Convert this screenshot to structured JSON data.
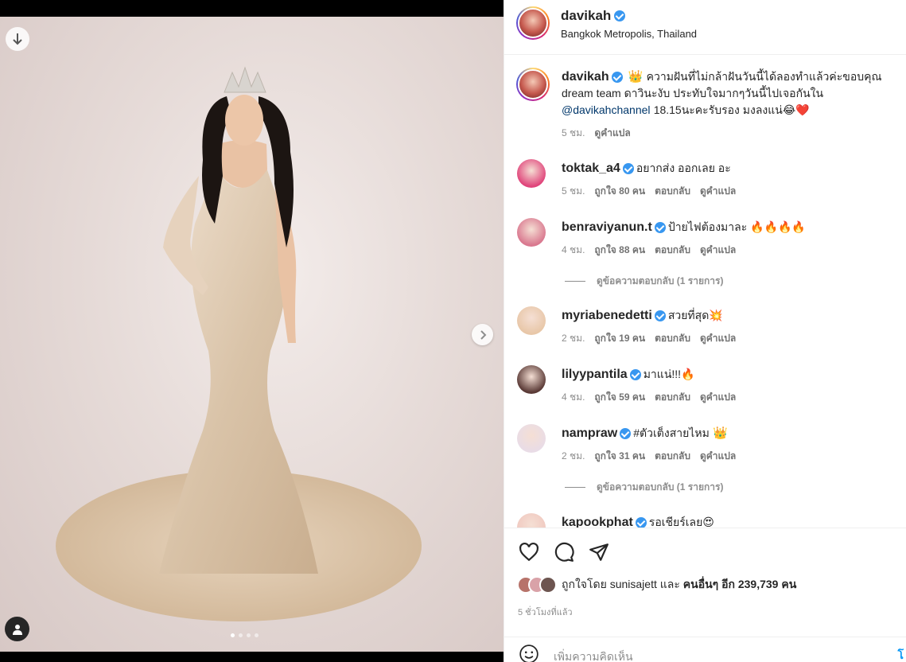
{
  "post": {
    "author": "davikah",
    "location": "Bangkok Metropolis, Thailand"
  },
  "caption": {
    "username": "davikah",
    "crown": "👑",
    "text_part1": "ความฝันที่ไม่กล้าฝันวันนี้ได้ลองทำแล้วค่ะขอบคุณ dream team ดาวินะงับ ประทับใจมากๆวันนี้ไปเจอกันใน",
    "mention": "@davikahchannel",
    "text_part2": "18.15นะคะรับรอง มงลงแน่😂❤️",
    "time": "5 ชม.",
    "translate": "ดูคำแปล"
  },
  "comments": [
    {
      "username": "toktak_a4",
      "text": "อยากส่ง ออกเลย อะ",
      "time": "5 ชม.",
      "likes": "ถูกใจ 80 คน",
      "reply": "ตอบกลับ",
      "translate": "ดูคำแปล",
      "avatar_color": "#e0457b"
    },
    {
      "username": "benraviyanun.t",
      "text": "ป้ายไฟต้องมาละ 🔥🔥🔥🔥",
      "time": "4 ชม.",
      "likes": "ถูกใจ 88 คน",
      "reply": "ตอบกลับ",
      "translate": "ดูคำแปล",
      "avatar_color": "#d9788f",
      "replies": "ดูข้อความตอบกลับ (1 รายการ)"
    },
    {
      "username": "myriabenedetti",
      "text": "สวยที่สุด💥",
      "time": "2 ชม.",
      "likes": "ถูกใจ 19 คน",
      "reply": "ตอบกลับ",
      "translate": "ดูคำแปล",
      "avatar_color": "#e8c7a8"
    },
    {
      "username": "lilyypantila",
      "text": "มาแน่!!!🔥",
      "time": "4 ชม.",
      "likes": "ถูกใจ 59 คน",
      "reply": "ตอบกลับ",
      "translate": "ดูคำแปล",
      "avatar_color": "#5a3a36"
    },
    {
      "username": "nampraw",
      "text": "#ตัวเต็งสายไหม",
      "crown": "👑",
      "time": "2 ชม.",
      "likes": "ถูกใจ 31 คน",
      "reply": "ตอบกลับ",
      "translate": "ดูคำแปล",
      "avatar_color": "#e9dce6",
      "replies": "ดูข้อความตอบกลับ (1 รายการ)"
    },
    {
      "username": "kapookphat",
      "text": "รอเชียร์เลย😍",
      "avatar_color": "#f0c9c0"
    }
  ],
  "likes": {
    "prefix": "ถูกใจโดย",
    "user": "sunisajett",
    "and": "และ",
    "others": "คนอื่นๆ อีก 239,739 คน"
  },
  "time_ago": "5 ชั่วโมงที่แล้ว",
  "add_comment": {
    "placeholder": "เพิ่มความคิดเห็น",
    "post": "โ"
  },
  "carousel": {
    "count": 4,
    "active": 0
  }
}
